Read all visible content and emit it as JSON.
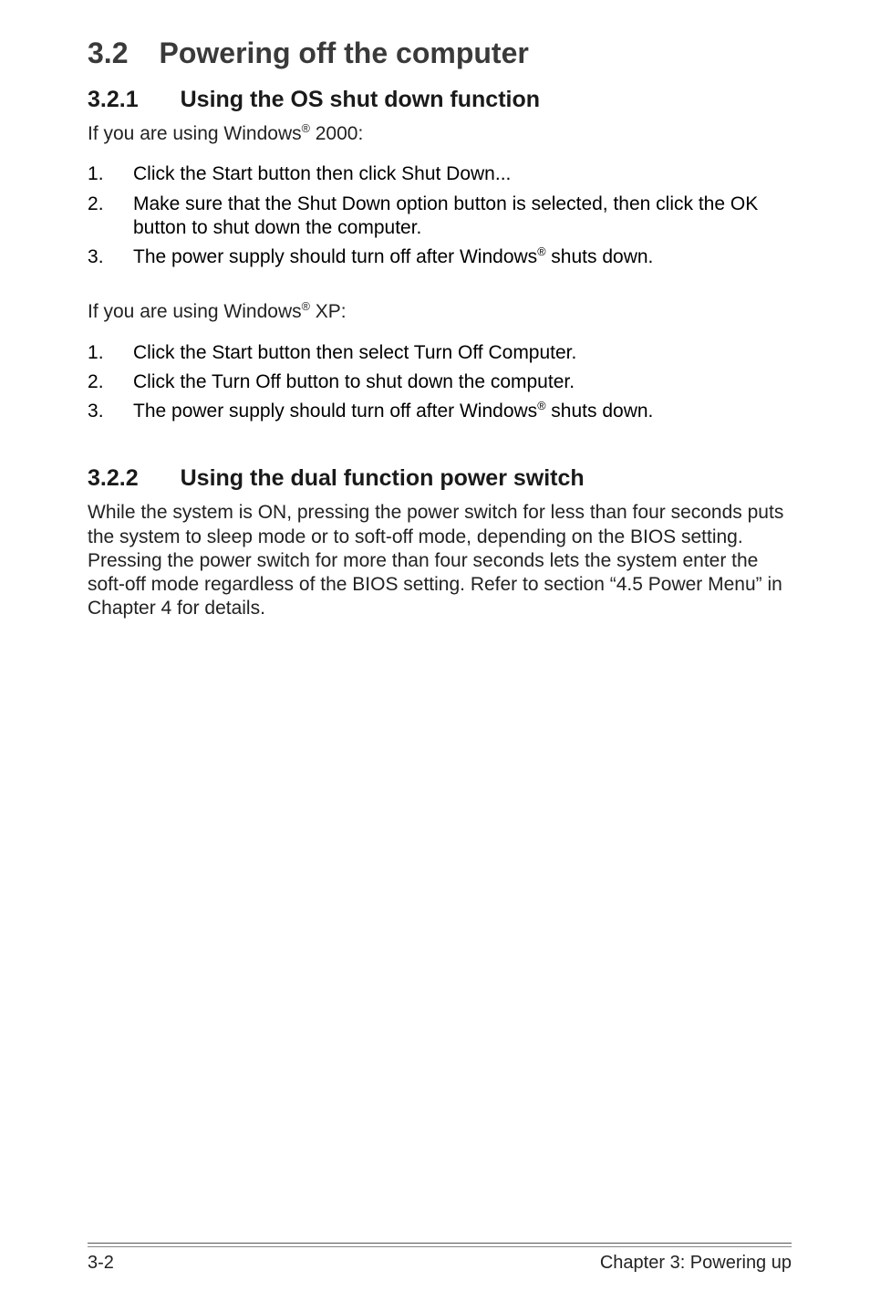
{
  "heading": {
    "number": "3.2",
    "title": "Powering off the computer"
  },
  "section1": {
    "number": "3.2.1",
    "title": "Using the OS shut down function",
    "intro2000_a": "If you are using Windows",
    "intro2000_b": " 2000:",
    "steps2000": [
      "Click the Start button then click Shut Down...",
      "Make sure that the Shut Down option button is selected, then click the OK button to shut down the computer."
    ],
    "step3_a": "The power supply should turn off after Windows",
    "step3_b": " shuts down.",
    "introXP_a": "If you are using Windows",
    "introXP_b": " XP:",
    "stepsXP": [
      "Click the Start button then select Turn Off Computer.",
      "Click the Turn Off button to shut down the computer."
    ]
  },
  "section2": {
    "number": "3.2.2",
    "title": "Using the dual function power switch",
    "body": "While the system is ON, pressing the power switch for less than four seconds puts the system to sleep mode or to soft-off mode, depending on the BIOS setting. Pressing the power switch for more than four seconds lets the system enter the soft-off mode regardless of the BIOS setting. Refer to section  “4.5  Power Menu” in Chapter 4 for details."
  },
  "reg": "®",
  "footer": {
    "left": "3-2",
    "right": "Chapter 3: Powering up"
  }
}
